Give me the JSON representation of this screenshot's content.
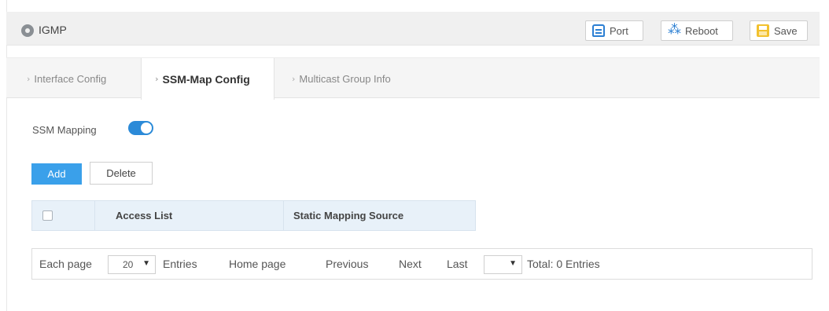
{
  "header": {
    "title": "IGMP",
    "buttons": {
      "port": "Port",
      "reboot": "Reboot",
      "save": "Save"
    }
  },
  "tabs": [
    {
      "label": "Interface Config",
      "active": false
    },
    {
      "label": "SSM-Map Config",
      "active": true
    },
    {
      "label": "Multicast Group Info",
      "active": false
    }
  ],
  "ssm": {
    "label": "SSM Mapping",
    "enabled": true
  },
  "actions": {
    "add": "Add",
    "delete": "Delete"
  },
  "table": {
    "columns": [
      "Access List",
      "Static Mapping Source"
    ],
    "rows": []
  },
  "pager": {
    "each_page": "Each page",
    "page_size": "20",
    "entries": "Entries",
    "home": "Home page",
    "previous": "Previous",
    "next": "Next",
    "last": "Last",
    "page_value": "",
    "total": "Total: 0 Entries"
  },
  "colors": {
    "accent": "#3aa0ea",
    "toggle_on": "#2b8ad8",
    "header_bg": "#f0f0f0"
  }
}
